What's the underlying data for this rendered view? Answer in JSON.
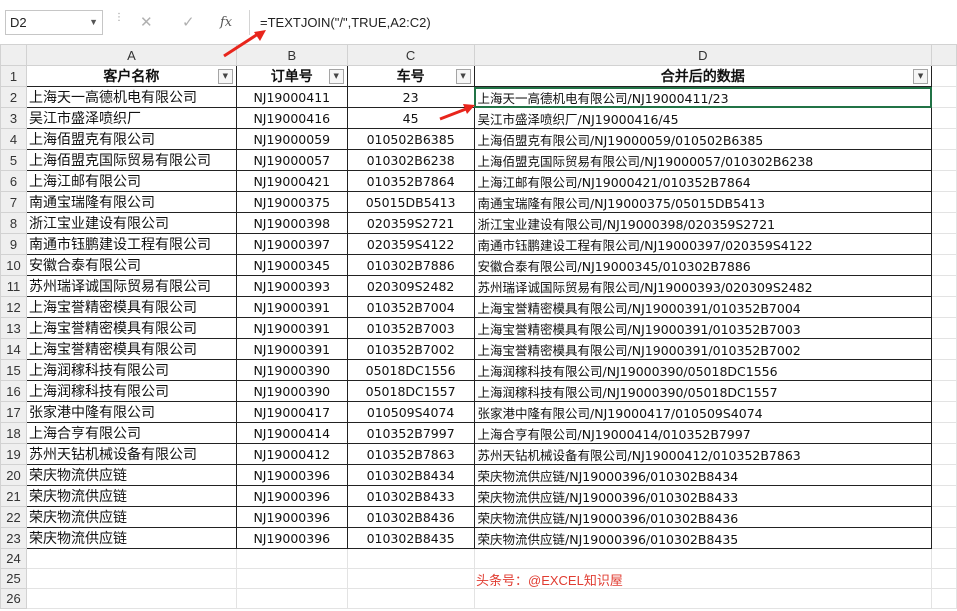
{
  "name_box": "D2",
  "formula": "=TEXTJOIN(\"/\",TRUE,A2:C2)",
  "fx_label": "fx",
  "columns": [
    "A",
    "B",
    "C",
    "D"
  ],
  "headers": [
    "客户名称",
    "订单号",
    "车号",
    "合并后的数据"
  ],
  "rows": [
    [
      "上海天一高德机电有限公司",
      "NJ19000411",
      "23",
      "上海天一高德机电有限公司/NJ19000411/23"
    ],
    [
      "吴江市盛泽喷织厂",
      "NJ19000416",
      "45",
      "吴江市盛泽喷织厂/NJ19000416/45"
    ],
    [
      "上海佰盟克有限公司",
      "NJ19000059",
      "010502B6385",
      "上海佰盟克有限公司/NJ19000059/010502B6385"
    ],
    [
      "上海佰盟克国际贸易有限公司",
      "NJ19000057",
      "010302B6238",
      "上海佰盟克国际贸易有限公司/NJ19000057/010302B6238"
    ],
    [
      "上海江邮有限公司",
      "NJ19000421",
      "010352B7864",
      "上海江邮有限公司/NJ19000421/010352B7864"
    ],
    [
      "南通宝瑞隆有限公司",
      "NJ19000375",
      "05015DB5413",
      "南通宝瑞隆有限公司/NJ19000375/05015DB5413"
    ],
    [
      "浙江宝业建设有限公司",
      "NJ19000398",
      "020359S2721",
      "浙江宝业建设有限公司/NJ19000398/020359S2721"
    ],
    [
      "南通市钰鹏建设工程有限公司",
      "NJ19000397",
      "020359S4122",
      "南通市钰鹏建设工程有限公司/NJ19000397/020359S4122"
    ],
    [
      "安徽合泰有限公司",
      "NJ19000345",
      "010302B7886",
      "安徽合泰有限公司/NJ19000345/010302B7886"
    ],
    [
      "苏州瑞译诚国际贸易有限公司",
      "NJ19000393",
      "020309S2482",
      "苏州瑞译诚国际贸易有限公司/NJ19000393/020309S2482"
    ],
    [
      "上海宝誉精密模具有限公司",
      "NJ19000391",
      "010352B7004",
      "上海宝誉精密模具有限公司/NJ19000391/010352B7004"
    ],
    [
      "上海宝誉精密模具有限公司",
      "NJ19000391",
      "010352B7003",
      "上海宝誉精密模具有限公司/NJ19000391/010352B7003"
    ],
    [
      "上海宝誉精密模具有限公司",
      "NJ19000391",
      "010352B7002",
      "上海宝誉精密模具有限公司/NJ19000391/010352B7002"
    ],
    [
      "上海润稼科技有限公司",
      "NJ19000390",
      "05018DC1556",
      "上海润稼科技有限公司/NJ19000390/05018DC1556"
    ],
    [
      "上海润稼科技有限公司",
      "NJ19000390",
      "05018DC1557",
      "上海润稼科技有限公司/NJ19000390/05018DC1557"
    ],
    [
      "张家港中隆有限公司",
      "NJ19000417",
      "010509S4074",
      "张家港中隆有限公司/NJ19000417/010509S4074"
    ],
    [
      "上海合亨有限公司",
      "NJ19000414",
      "010352B7997",
      "上海合亨有限公司/NJ19000414/010352B7997"
    ],
    [
      "苏州天钻机械设备有限公司",
      "NJ19000412",
      "010352B7863",
      "苏州天钻机械设备有限公司/NJ19000412/010352B7863"
    ],
    [
      "荣庆物流供应链",
      "NJ19000396",
      "010302B8434",
      "荣庆物流供应链/NJ19000396/010302B8434"
    ],
    [
      "荣庆物流供应链",
      "NJ19000396",
      "010302B8433",
      "荣庆物流供应链/NJ19000396/010302B8433"
    ],
    [
      "荣庆物流供应链",
      "NJ19000396",
      "010302B8436",
      "荣庆物流供应链/NJ19000396/010302B8436"
    ],
    [
      "荣庆物流供应链",
      "NJ19000396",
      "010302B8435",
      "荣庆物流供应链/NJ19000396/010302B8435"
    ]
  ],
  "row_numbers": [
    "1",
    "2",
    "3",
    "4",
    "5",
    "6",
    "7",
    "8",
    "9",
    "10",
    "11",
    "12",
    "13",
    "14",
    "15",
    "16",
    "17",
    "18",
    "19",
    "20",
    "21",
    "22",
    "23",
    "24",
    "25",
    "26"
  ],
  "watermark": "头条号：@EXCEL知识屋",
  "accent_arrow_color": "#e8251c",
  "selected_cell": "D2"
}
